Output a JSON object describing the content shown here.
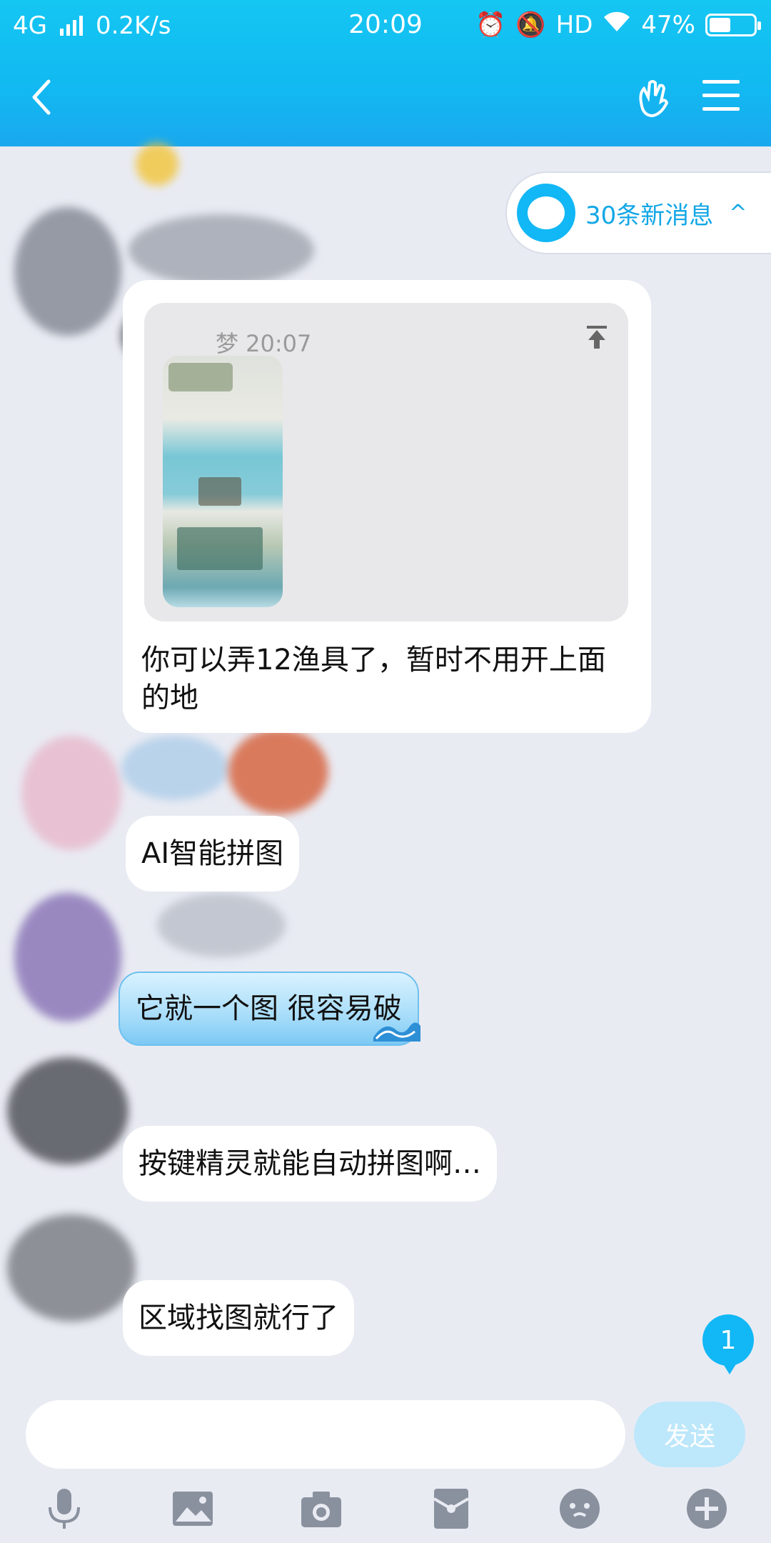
{
  "status_bar": {
    "network": "4G",
    "speed": "0.2K/s",
    "time": "20:09",
    "hd": "HD",
    "battery": "47%",
    "battery_level": 0.47
  },
  "header": {
    "back_icon": "chevron-left-icon",
    "hand_icon": "hand-gesture-icon",
    "menu_icon": "menu-icon"
  },
  "new_messages": {
    "label": "30条新消息",
    "icon": "chat-bubble-icon",
    "chevron": "^"
  },
  "messages": [
    {
      "quote": {
        "meta": "梦 20:07",
        "pin_icon": "pin-top-icon",
        "has_thumbnail": true
      },
      "text": "你可以弄12渔具了，暂时不用开上面的地"
    },
    {
      "text": "AI智能拼图"
    },
    {
      "text": "它就一个图 很容易破"
    },
    {
      "text": "按键精灵就能自动拼图啊…"
    },
    {
      "text": "区域找图就行了"
    }
  ],
  "unread_badge": "1",
  "composer": {
    "input_value": "",
    "placeholder": "",
    "send_label": "发送"
  },
  "toolbar": [
    "microphone-icon",
    "image-icon",
    "camera-icon",
    "red-packet-icon",
    "emoji-icon",
    "plus-icon"
  ],
  "colors": {
    "accent": "#12b7f5",
    "background": "#e9ebf3",
    "bubble": "#ffffff"
  }
}
